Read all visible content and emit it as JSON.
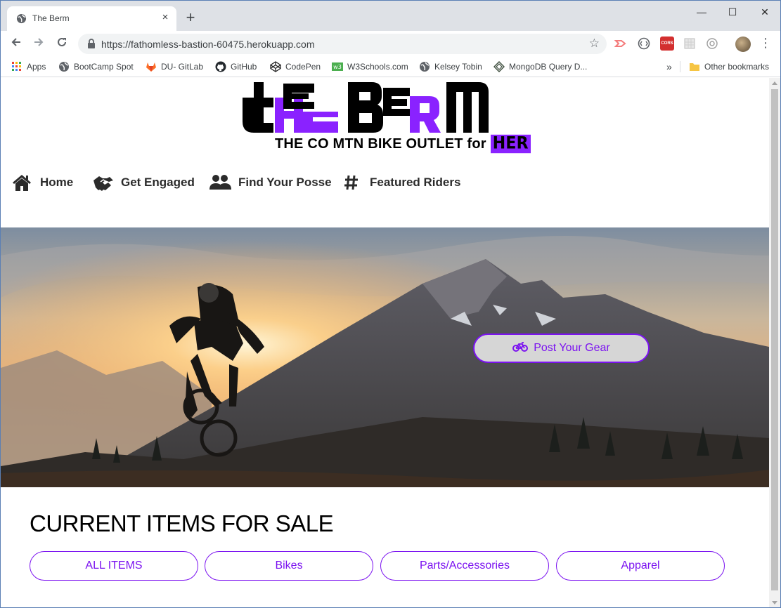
{
  "browser": {
    "tab_title": "The Berm",
    "tab_close": "×",
    "new_tab": "+",
    "url": "https://fathomless-bastion-60475.herokuapp.com",
    "window_controls": [
      "—",
      "☐",
      "✕"
    ],
    "bookmarks": [
      {
        "label": "Apps",
        "icon": "apps-grid-icon"
      },
      {
        "label": "BootCamp Spot",
        "icon": "globe-icon"
      },
      {
        "label": "DU- GitLab",
        "icon": "gitlab-icon"
      },
      {
        "label": "GitHub",
        "icon": "github-icon"
      },
      {
        "label": "CodePen",
        "icon": "codepen-icon"
      },
      {
        "label": "W3Schools.com",
        "icon": "w3schools-icon"
      },
      {
        "label": "Kelsey Tobin",
        "icon": "globe-icon"
      },
      {
        "label": "MongoDB Query D...",
        "icon": "mongodb-icon"
      }
    ],
    "overflow": "»",
    "other_bookmarks": "Other bookmarks",
    "extension_labels": {
      "cors": "CORS"
    }
  },
  "page": {
    "logo_text": "THE BERM",
    "tagline": "THE CO MTN BIKE OUTLET for",
    "tagline_her": "HER",
    "nav": [
      {
        "label": "Home",
        "icon": "home-icon"
      },
      {
        "label": "Get Engaged",
        "icon": "handshake-icon"
      },
      {
        "label": "Find Your Posse",
        "icon": "users-icon"
      },
      {
        "label": "Featured Riders",
        "icon": "hashtag-icon"
      }
    ],
    "hero": {
      "image": "mountain-biker-sunset",
      "post_button": "Post Your Gear"
    },
    "items_title": "CURRENT ITEMS FOR SALE",
    "filters": [
      "ALL ITEMS",
      "Bikes",
      "Parts/Accessories",
      "Apparel"
    ]
  },
  "colors": {
    "accent": "#7b12f0",
    "logo_purple": "#8a22ff",
    "chrome_tabstrip": "#dee1e6",
    "omnibox": "#f1f3f4"
  }
}
